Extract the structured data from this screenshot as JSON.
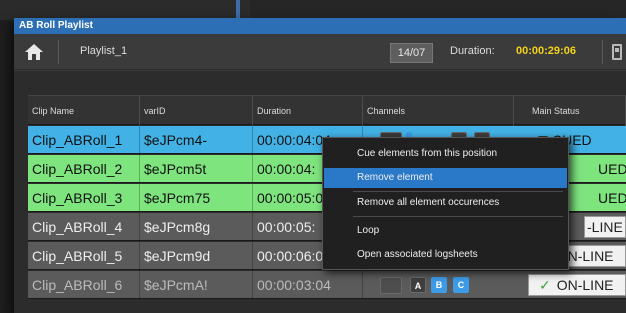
{
  "window": {
    "title": "AB Roll Playlist"
  },
  "toolbar": {
    "playlist_name": "Playlist_1",
    "counter": "14/07",
    "duration_label": "Duration:",
    "duration_value": "00:00:29:06"
  },
  "columns": [
    "Clip Name",
    "varID",
    "Duration",
    "Channels",
    "Main Status"
  ],
  "rows": [
    {
      "name": "Clip_ABRoll_1",
      "varid": "$eJPcm4-",
      "duration": "00:00:04:04",
      "status": "CUED"
    },
    {
      "name": "Clip_ABRoll_2",
      "varid": "$eJPcm5t",
      "duration": "00:00:04:",
      "status": "UED"
    },
    {
      "name": "Clip_ABRoll_3",
      "varid": "$eJPcm75",
      "duration": "00:00:05:0",
      "status": "UED"
    },
    {
      "name": "Clip_ABRoll_4",
      "varid": "$eJPcm8g",
      "duration": "00:00:05:",
      "status": "-LINE"
    },
    {
      "name": "Clip_ABRoll_5",
      "varid": "$eJPcm9d",
      "duration": "00:00:06:08",
      "status": "ON-LINE"
    },
    {
      "name": "Clip_ABRoll_6",
      "varid": "$eJPcmA!",
      "duration": "00:00:03:04",
      "status": "ON-LINE"
    }
  ],
  "channel_labels": {
    "a": "A",
    "b": "B",
    "c": "C"
  },
  "context_menu": {
    "items": [
      "Cue elements from this position",
      "Remove element",
      "Remove all element occurences",
      "Loop",
      "Open associated logsheets"
    ],
    "highlighted_index": 1
  },
  "colors": {
    "selected_row": "#42b2e6",
    "cued_row": "#7ee47e",
    "online_row": "#5b5b5b",
    "duration_value": "#f2d21c",
    "channel_active": "#3d9be8",
    "menu_highlight": "#2a78c8"
  },
  "icons": {
    "home": "home-icon",
    "toolbar_right": "device-icon",
    "status_ok": "check-icon",
    "status_cued": "triangle-down-icon"
  }
}
